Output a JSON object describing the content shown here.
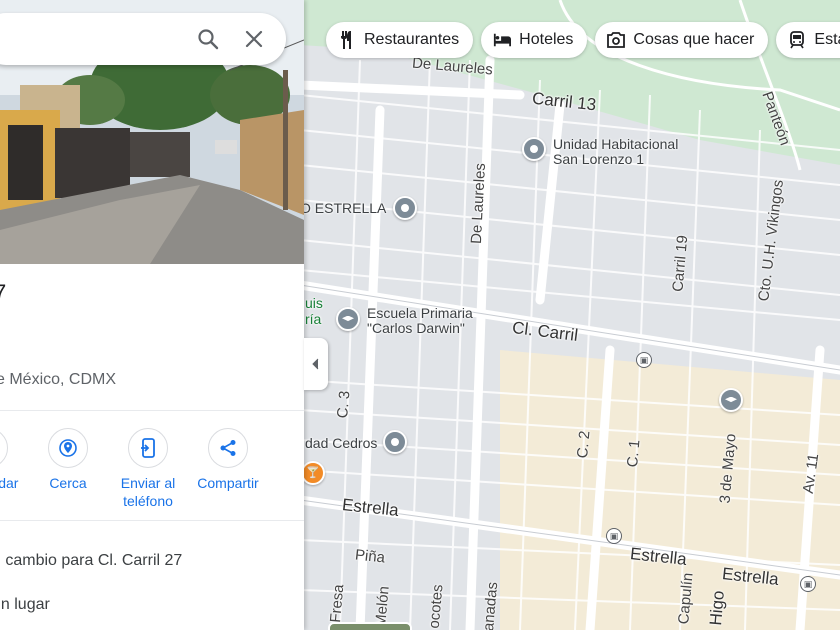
{
  "search": {
    "value": "",
    "placeholder": ""
  },
  "place": {
    "title": "7",
    "address": "e México, CDMX"
  },
  "actions": [
    {
      "label": "rdar",
      "icon": "bookmark-icon"
    },
    {
      "label": "Cerca",
      "icon": "nearby-icon"
    },
    {
      "label": "Enviar al teléfono",
      "icon": "send-to-phone-icon"
    },
    {
      "label": "Compartir",
      "icon": "share-icon"
    }
  ],
  "rows": [
    {
      "label": "n cambio para Cl. Carril 27"
    },
    {
      "label": "un lugar"
    }
  ],
  "chips": [
    {
      "label": "Restaurantes",
      "icon": "restaurant-icon"
    },
    {
      "label": "Hoteles",
      "icon": "hotel-icon"
    },
    {
      "label": "Cosas que hacer",
      "icon": "camera-icon"
    },
    {
      "label": "Estaci",
      "icon": "transit-icon"
    }
  ],
  "map_labels": {
    "de_laureles_top": "De Laureles",
    "carril_13": "Carril 13",
    "unidad_habitacional_1": "Unidad Habitacional",
    "unidad_habitacional_2": "San Lorenzo 1",
    "panteon": "Panteón",
    "estrella_poi": "O ESTRELLA",
    "de_laureles_vertical": "De Laureles",
    "carril_19": "Carril 19",
    "cto_vikingos": "Cto. U.H. Vikingos",
    "luis_1": "uis",
    "luis_2": "ría",
    "escuela_1": "Escuela Primaria",
    "escuela_2": "\"Carlos Darwin\"",
    "cl_carril": "Cl. Carril",
    "c3": "C. 3",
    "dad_cedros": "dad Cedros",
    "c2": "C. 2",
    "c1": "C. 1",
    "tres_de_mayo": "3 de Mayo",
    "av_11": "Av. 11",
    "estrella_left": "Estrella",
    "estrella_mid": "Estrella",
    "estrella_right": "Estrella",
    "pina": "Piña",
    "fresa": "Fresa",
    "melon": "Melón",
    "cocotes": "ocotes",
    "granadas": "anadas",
    "capulin": "Capulín",
    "higo": "Higo"
  },
  "colors": {
    "accent": "#1a73e8",
    "park": "#c8e6c9",
    "pin": "#ea4335",
    "road": "#ffffff",
    "block": "#d9dde3",
    "yellow_block": "#fdf1c9"
  }
}
